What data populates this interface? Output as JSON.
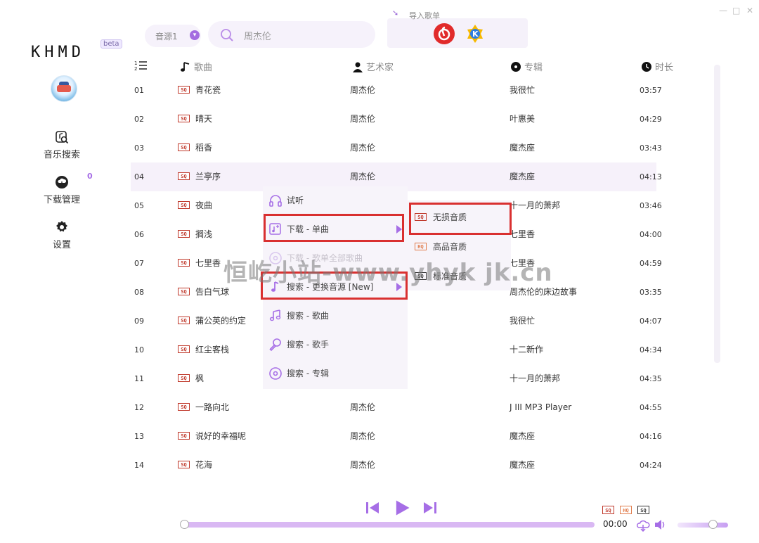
{
  "window": {
    "minimize": "—",
    "maximize": "□",
    "close": "✕"
  },
  "sidebar": {
    "logo": "KHMD",
    "beta": "beta",
    "items": [
      {
        "label": "音乐搜索",
        "icon": "music-search-icon"
      },
      {
        "label": "下载管理",
        "icon": "cloud-download-icon",
        "badge": "0"
      },
      {
        "label": "设置",
        "icon": "gear-icon"
      }
    ]
  },
  "topbar": {
    "source_label": "音源1",
    "search_value": "周杰伦",
    "import_label": "导入歌单"
  },
  "table": {
    "headers": {
      "title": "歌曲",
      "artist": "艺术家",
      "album": "专辑",
      "duration": "时长"
    },
    "rows": [
      {
        "num": "01",
        "tag": "SQ",
        "title": "青花瓷",
        "artist": "周杰伦",
        "album": "我很忙",
        "duration": "03:57"
      },
      {
        "num": "02",
        "tag": "SQ",
        "title": "晴天",
        "artist": "周杰伦",
        "album": "叶惠美",
        "duration": "04:29"
      },
      {
        "num": "03",
        "tag": "SQ",
        "title": "稻香",
        "artist": "周杰伦",
        "album": "魔杰座",
        "duration": "03:43"
      },
      {
        "num": "04",
        "tag": "SQ",
        "title": "兰亭序",
        "artist": "周杰伦",
        "album": "魔杰座",
        "duration": "04:13"
      },
      {
        "num": "05",
        "tag": "SQ",
        "title": "夜曲",
        "artist": "",
        "album": "十一月的萧邦",
        "duration": "03:46"
      },
      {
        "num": "06",
        "tag": "SQ",
        "title": "搁浅",
        "artist": "",
        "album": "七里香",
        "duration": "04:00"
      },
      {
        "num": "07",
        "tag": "SQ",
        "title": "七里香",
        "artist": "",
        "album": "七里香",
        "duration": "04:59"
      },
      {
        "num": "08",
        "tag": "SQ",
        "title": "告白气球",
        "artist": "",
        "album": "周杰伦的床边故事",
        "duration": "03:35"
      },
      {
        "num": "09",
        "tag": "SQ",
        "title": "蒲公英的约定",
        "artist": "",
        "album": "我很忙",
        "duration": "04:07"
      },
      {
        "num": "10",
        "tag": "SQ",
        "title": "红尘客栈",
        "artist": "",
        "album": "十二新作",
        "duration": "04:34"
      },
      {
        "num": "11",
        "tag": "SQ",
        "title": "枫",
        "artist": "",
        "album": "十一月的萧邦",
        "duration": "04:35"
      },
      {
        "num": "12",
        "tag": "SQ",
        "title": "一路向北",
        "artist": "周杰伦",
        "album": "J III MP3 Player",
        "duration": "04:55"
      },
      {
        "num": "13",
        "tag": "SQ",
        "title": "说好的幸福呢",
        "artist": "周杰伦",
        "album": "魔杰座",
        "duration": "04:16"
      },
      {
        "num": "14",
        "tag": "SQ",
        "title": "花海",
        "artist": "周杰伦",
        "album": "魔杰座",
        "duration": "04:24"
      }
    ]
  },
  "context_menu": {
    "items": [
      {
        "label": "试听",
        "icon": "headphones-icon"
      },
      {
        "label": "下载 - 单曲",
        "icon": "music-add-icon"
      },
      {
        "label": "下载 - 歌单全部歌曲",
        "icon": "disc-icon"
      },
      {
        "label": "搜索 - 更换音源 [New]",
        "icon": "music-note-icon"
      },
      {
        "label": "搜索 - 歌曲",
        "icon": "music-notes-icon"
      },
      {
        "label": "搜索 - 歌手",
        "icon": "microphone-icon"
      },
      {
        "label": "搜索 - 专辑",
        "icon": "disc-icon"
      }
    ]
  },
  "submenu": {
    "items": [
      {
        "tag": "SQ",
        "label": "无损音质"
      },
      {
        "tag": "HQ",
        "label": "高品音质"
      },
      {
        "tag": "SQ",
        "label": "标准音质"
      }
    ]
  },
  "watermark": "恒屹小站-www.yhyk jk.cn",
  "player": {
    "time": "00:00",
    "progress": 0,
    "volume": 0.7,
    "quality_tags": [
      "SQ",
      "HQ",
      "SQ"
    ]
  },
  "colors": {
    "accent": "#a66ee6",
    "sq_red": "#c0392b",
    "highlight_red": "#d93030"
  }
}
